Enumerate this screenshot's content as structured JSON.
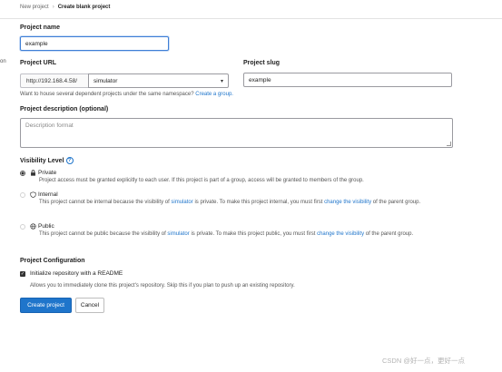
{
  "breadcrumb": {
    "parent": "New project",
    "separator": "›",
    "current": "Create blank project"
  },
  "edge_fragment": "on",
  "form": {
    "project_name": {
      "label": "Project name",
      "value": "example"
    },
    "project_url": {
      "label": "Project URL",
      "prefix": "http://192.168.4.58/",
      "namespace": "simulator"
    },
    "project_slug": {
      "label": "Project slug",
      "value": "example"
    },
    "namespace_help": {
      "text": "Want to house several dependent projects under the same namespace?",
      "link": "Create a group."
    },
    "description": {
      "label": "Project description (optional)",
      "placeholder": "Description format"
    },
    "visibility": {
      "label": "Visibility Level",
      "help_icon": "question-circle-icon",
      "selected": "private",
      "private": {
        "title": "Private",
        "icon": "lock-icon",
        "desc": "Project access must be granted explicitly to each user. If this project is part of a group, access will be granted to members of the group."
      },
      "internal": {
        "title": "Internal",
        "icon": "shield-icon",
        "desc_a": "This project cannot be internal because the visibility of",
        "desc_link": "simulator",
        "desc_b": "is private. To make this project internal, you must first",
        "desc_link2": "change the visibility",
        "desc_c": "of the parent group."
      },
      "public": {
        "title": "Public",
        "icon": "globe-icon",
        "desc_a": "This project cannot be public because the visibility of",
        "desc_link": "simulator",
        "desc_b": "is private. To make this project public, you must first",
        "desc_link2": "change the visibility",
        "desc_c": "of the parent group."
      }
    },
    "configuration": {
      "label": "Project Configuration",
      "init_readme": {
        "label": "Initialize repository with a README",
        "checked": true,
        "help": "Allows you to immediately clone this project's repository. Skip this if you plan to push up an existing repository."
      }
    },
    "buttons": {
      "create": "Create project",
      "cancel": "Cancel"
    }
  },
  "watermark": "CSDN @好一点，更好一点",
  "colors": {
    "primary": "#1f75cb",
    "link": "#1f75cb",
    "focus_border": "#3f7fd6"
  }
}
